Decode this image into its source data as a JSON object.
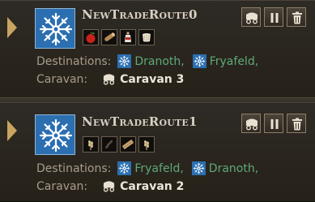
{
  "colors": {
    "panel": "#2e2a25",
    "accent_arrow": "#c9a461",
    "emblem_blue": "#2b6fb1",
    "destination_green": "#5fa878",
    "caravan_text": "#ece6da"
  },
  "buttons": {
    "caravan_icon": "wagon-icon",
    "pause_icon": "pause-icon",
    "delete_icon": "trash-icon"
  },
  "routes": [
    {
      "name": "NewTradeRoute0",
      "goods": [
        "apple-icon",
        "wood-log-icon",
        "potion-bottle-icon",
        "cloth-icon"
      ],
      "destinations_label": "Destinations:",
      "destinations": [
        "Dranoth,",
        "Fryafeld,"
      ],
      "caravan_label": "Caravan:",
      "caravan": "Caravan 3"
    },
    {
      "name": "NewTradeRoute1",
      "goods": [
        "wheat-icon",
        "grain-icon",
        "wood-plank-icon",
        "wheat-icon"
      ],
      "destinations_label": "Destinations:",
      "destinations": [
        "Fryafeld,",
        "Dranoth,"
      ],
      "caravan_label": "Caravan:",
      "caravan": "Caravan 2"
    }
  ]
}
